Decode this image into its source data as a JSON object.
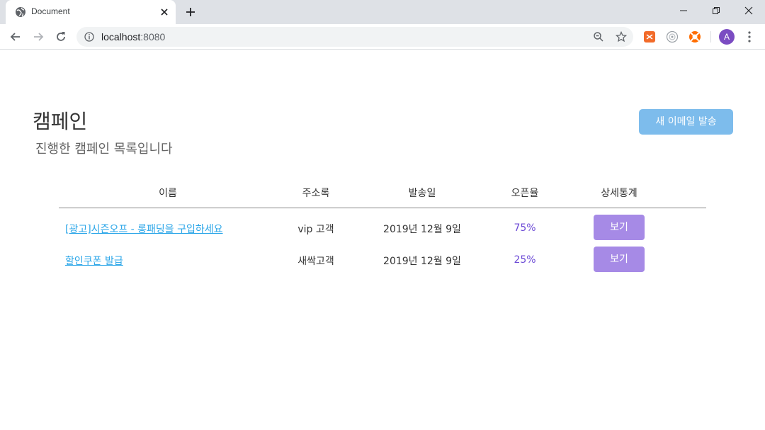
{
  "browser": {
    "tab_title": "Document",
    "url_host": "localhost",
    "url_port": ":8080",
    "avatar_letter": "A"
  },
  "page": {
    "title": "캠페인",
    "subtitle": "진행한 캠페인 목록입니다",
    "new_email_button": "새 이메일 발송"
  },
  "table": {
    "headers": [
      "이름",
      "주소록",
      "발송일",
      "오픈율",
      "상세통계"
    ],
    "rows": [
      {
        "name": "[광고]시즌오프 - 롱패딩을 구입하세요",
        "address_book": "vip 고객",
        "sent_date": "2019년 12월 9일",
        "open_rate": "75%",
        "action": "보기"
      },
      {
        "name": "할인쿠폰 발급",
        "address_book": "새싹고객",
        "sent_date": "2019년 12월 9일",
        "open_rate": "25%",
        "action": "보기"
      }
    ]
  },
  "colors": {
    "primary_button": "#7dbcec",
    "view_button": "#a68ae6",
    "link": "#2ba6e8",
    "open_rate": "#6c4ad6"
  }
}
